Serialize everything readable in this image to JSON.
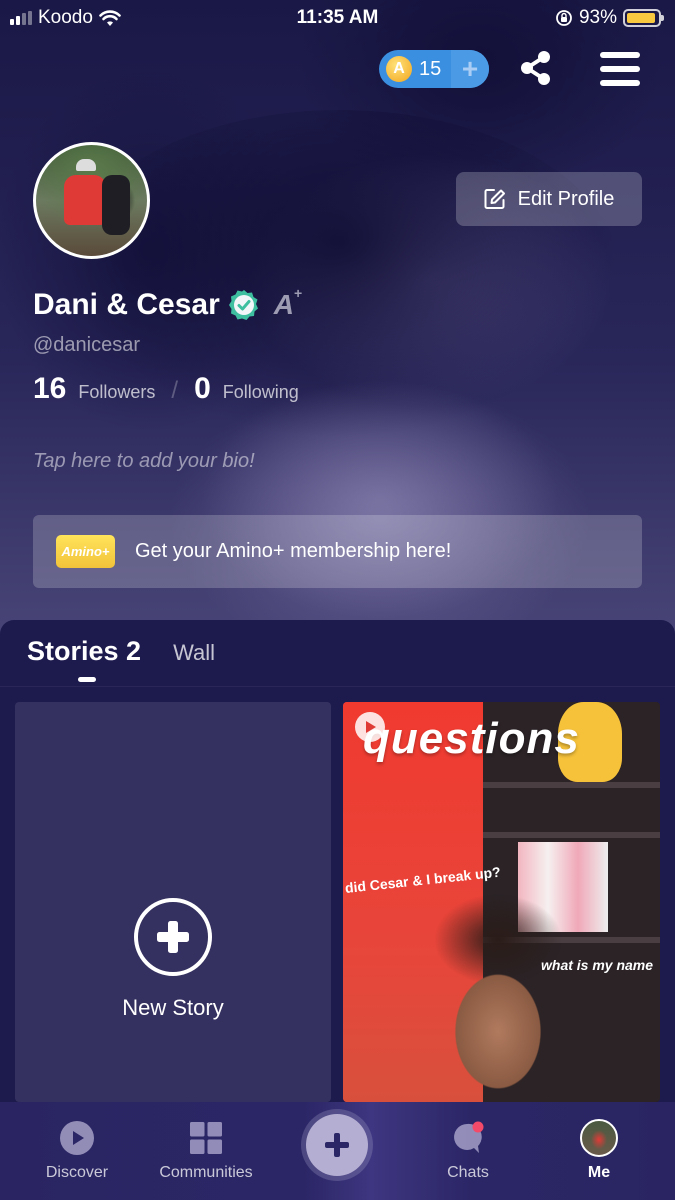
{
  "status_bar": {
    "carrier": "Koodo",
    "time": "11:35 AM",
    "battery_percent": "93%",
    "battery_level": 0.93,
    "battery_color": "#f7c840"
  },
  "top_bar": {
    "coins": "15",
    "coin_icon_letter": "A",
    "add_coins_icon": "plus-icon",
    "share_icon": "share-icon",
    "menu_icon": "hamburger-menu-icon"
  },
  "profile": {
    "edit_profile_label": "Edit Profile",
    "display_name": "Dani & Cesar",
    "verified_color": "#3dbfa0",
    "aplus_label": "A",
    "handle": "@danicesar",
    "followers_count": "16",
    "followers_label": "Followers",
    "following_count": "0",
    "following_label": "Following",
    "bio_placeholder": "Tap here to add your bio!"
  },
  "amino_banner": {
    "badge_text": "Amino+",
    "text": "Get your Amino+ membership here!"
  },
  "tabs": [
    {
      "label": "Stories 2",
      "active": true
    },
    {
      "label": "Wall",
      "active": false
    }
  ],
  "stories": {
    "new_story_label": "New Story",
    "video": {
      "caption_title": "questions",
      "caption_line1": "did Cesar & I break up?",
      "caption_line2": "what is my name"
    }
  },
  "bottom_nav": [
    {
      "label": "Discover",
      "icon": "play-circle-icon",
      "active": false
    },
    {
      "label": "Communities",
      "icon": "grid-icon",
      "active": false
    },
    {
      "label": "",
      "icon": "plus-icon",
      "active": false
    },
    {
      "label": "Chats",
      "icon": "chat-bubble-icon",
      "active": false,
      "badge_color": "#f24a68"
    },
    {
      "label": "Me",
      "icon": "avatar",
      "active": true
    }
  ]
}
